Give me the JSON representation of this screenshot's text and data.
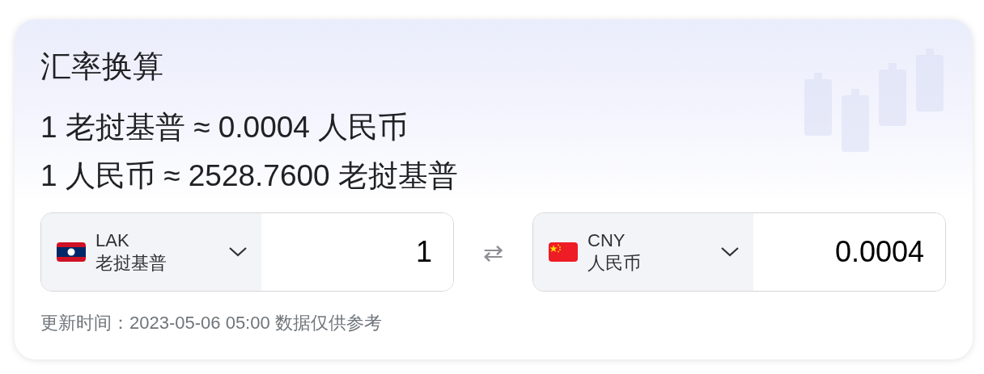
{
  "title": "汇率换算",
  "rates": [
    "1 老挝基普 ≈ 0.0004 人民币",
    "1 人民币 ≈ 2528.7600 老挝基普"
  ],
  "converters": [
    {
      "kind": "la",
      "code": "LAK",
      "name": "老挝基普",
      "amount": "1"
    },
    {
      "kind": "cn",
      "code": "CNY",
      "name": "人民币",
      "amount": "0.0004"
    }
  ],
  "swap_icon": "⇄",
  "footer": "更新时间：2023-05-06 05:00 数据仅供参考"
}
